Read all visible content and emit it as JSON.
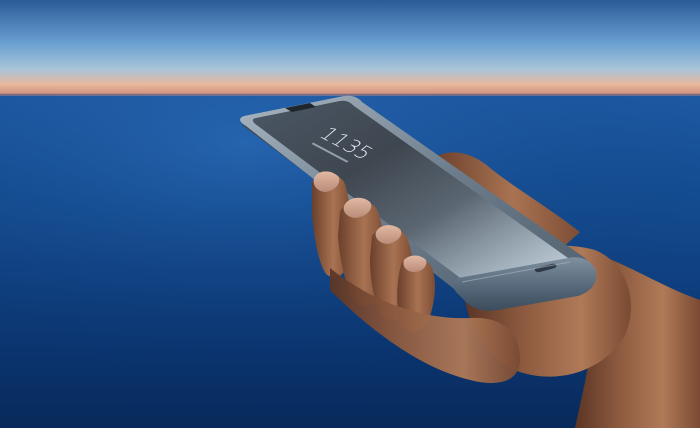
{
  "photo": {
    "subject": "foldable-phone-in-hand",
    "palette": {
      "sky_top": "#2f5e9a",
      "horizon_glow": "#f0a98a",
      "sea": "#0c3a78",
      "phone_body": "#5d6f80",
      "skin": "#b07a58"
    }
  },
  "lockscreen": {
    "time_hours": "11",
    "time_minutes": "35"
  }
}
